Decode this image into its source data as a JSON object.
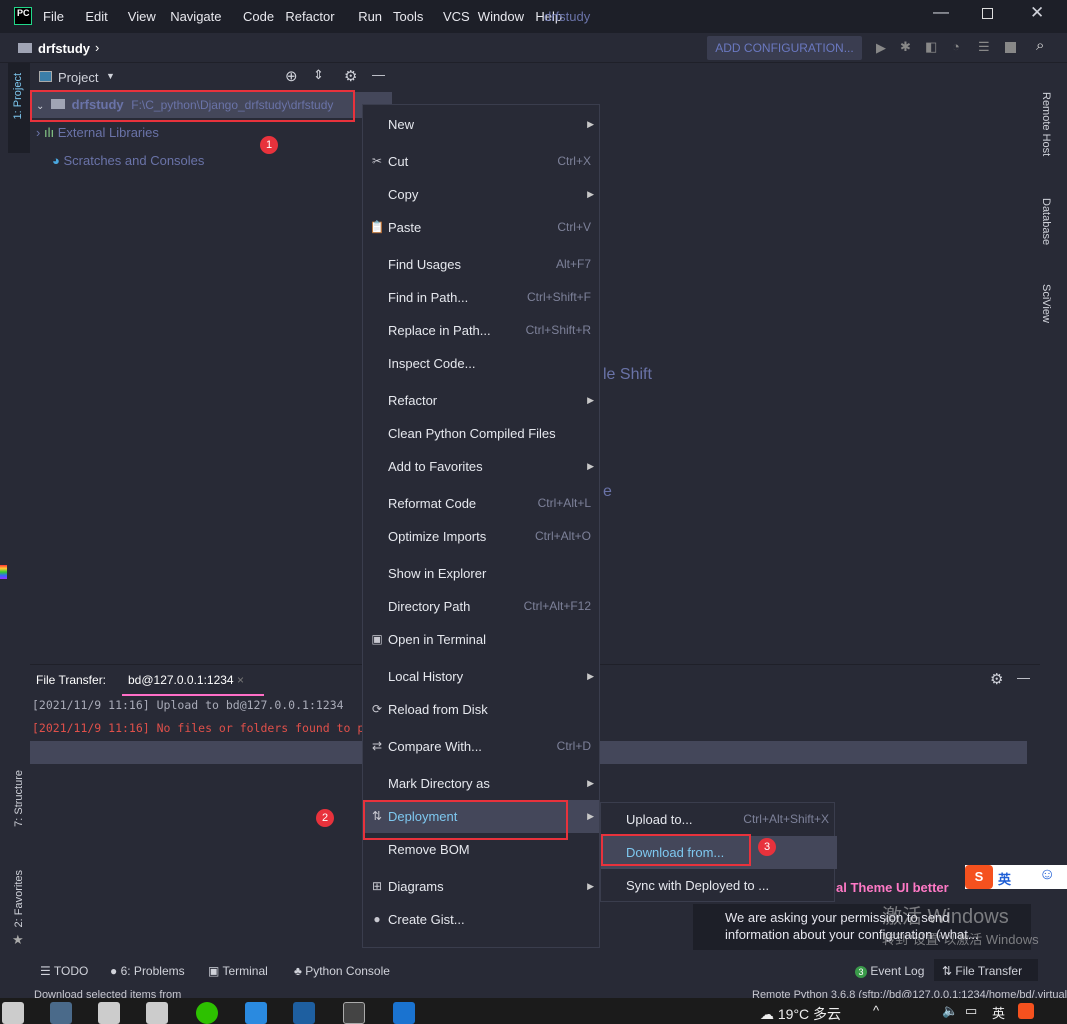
{
  "window": {
    "title": "drfstudy",
    "app_icon": "PC"
  },
  "menubar": [
    "File",
    "Edit",
    "View",
    "Navigate",
    "Code",
    "Refactor",
    "Run",
    "Tools",
    "VCS",
    "Window",
    "Help"
  ],
  "navbar": {
    "breadcrumb": "drfstudy",
    "add_config": "ADD CONFIGURATION..."
  },
  "left_strip": {
    "project": "1: Project",
    "structure": "7: Structure",
    "favorites": "2: Favorites"
  },
  "right_strip": [
    "Remote Host",
    "Database",
    "SciView"
  ],
  "project_panel": {
    "title": "Project",
    "root_name": "drfstudy",
    "root_path": "F:\\C_python\\Django_drfstudy\\drfstudy",
    "external": "External Libraries",
    "scratches": "Scratches and Consoles"
  },
  "editor_hints": {
    "hint1": "le Shift",
    "hint2": "e"
  },
  "file_transfer": {
    "label": "File Transfer:",
    "tab": "bd@127.0.0.1:1234",
    "log": [
      {
        "text": "[2021/11/9 11:16] Upload to bd@127.0.0.1:1234",
        "color": "#a9abb8"
      },
      {
        "text": "[2021/11/9 11:16] No files or folders found to p",
        "color": "#e0504a"
      }
    ]
  },
  "context_menu": [
    {
      "label": "New",
      "arrow": true,
      "sep": true
    },
    {
      "label": "Cut",
      "shortcut": "Ctrl+X",
      "icon": "✂"
    },
    {
      "label": "Copy",
      "arrow": true
    },
    {
      "label": "Paste",
      "shortcut": "Ctrl+V",
      "icon": "📋",
      "sep": true
    },
    {
      "label": "Find Usages",
      "shortcut": "Alt+F7"
    },
    {
      "label": "Find in Path...",
      "shortcut": "Ctrl+Shift+F"
    },
    {
      "label": "Replace in Path...",
      "shortcut": "Ctrl+Shift+R"
    },
    {
      "label": "Inspect Code...",
      "sep": true
    },
    {
      "label": "Refactor",
      "arrow": true
    },
    {
      "label": "Clean Python Compiled Files"
    },
    {
      "label": "Add to Favorites",
      "arrow": true,
      "sep": true
    },
    {
      "label": "Reformat Code",
      "shortcut": "Ctrl+Alt+L"
    },
    {
      "label": "Optimize Imports",
      "shortcut": "Ctrl+Alt+O",
      "sep": true
    },
    {
      "label": "Show in Explorer"
    },
    {
      "label": "Directory Path",
      "shortcut": "Ctrl+Alt+F12"
    },
    {
      "label": "Open in Terminal",
      "icon": "▣",
      "sep": true
    },
    {
      "label": "Local History",
      "arrow": true
    },
    {
      "label": "Reload from Disk",
      "icon": "⟳",
      "sep": true
    },
    {
      "label": "Compare With...",
      "shortcut": "Ctrl+D",
      "icon": "⇄",
      "sep": true
    },
    {
      "label": "Mark Directory as",
      "arrow": true
    },
    {
      "label": "Deployment",
      "arrow": true,
      "icon": "⇅",
      "selected": true
    },
    {
      "label": "Remove BOM",
      "sep": true
    },
    {
      "label": "Diagrams",
      "arrow": true,
      "icon": "⊞"
    },
    {
      "label": "Create Gist...",
      "icon": "●"
    }
  ],
  "deployment_submenu": [
    {
      "label": "Upload to...",
      "shortcut": "Ctrl+Alt+Shift+X"
    },
    {
      "label": "Download from...",
      "selected": true
    },
    {
      "label": "Sync with Deployed to ..."
    }
  ],
  "annotations": [
    "1",
    "2",
    "3"
  ],
  "notification": {
    "title": "al Theme UI better",
    "body1": "We are asking your permission to send",
    "body2": "information about your configuration (what..."
  },
  "watermark": {
    "line1": "激活 Windows",
    "line2": "转到\"设置\"以激活 Windows"
  },
  "ime": {
    "lang": "英"
  },
  "bottom_tools": {
    "todo": "TODO",
    "problems": "6: Problems",
    "terminal": "Terminal",
    "python_console": "Python Console",
    "event_log": "Event Log",
    "event_count": "3",
    "file_transfer": "File Transfer"
  },
  "status": {
    "text": "Download selected items from",
    "interpreter": "Remote Python 3.6.8 (sftp://bd@127.0.0.1:1234/home/bd/.virtualenvs/..."
  },
  "taskbar": {
    "weather": "19°C 多云",
    "ime": "英"
  },
  "colors": {
    "accent": "#e8323c",
    "selection": "#44475a",
    "link": "#7ec8f0",
    "tab_underline": "#ff6ec7"
  }
}
